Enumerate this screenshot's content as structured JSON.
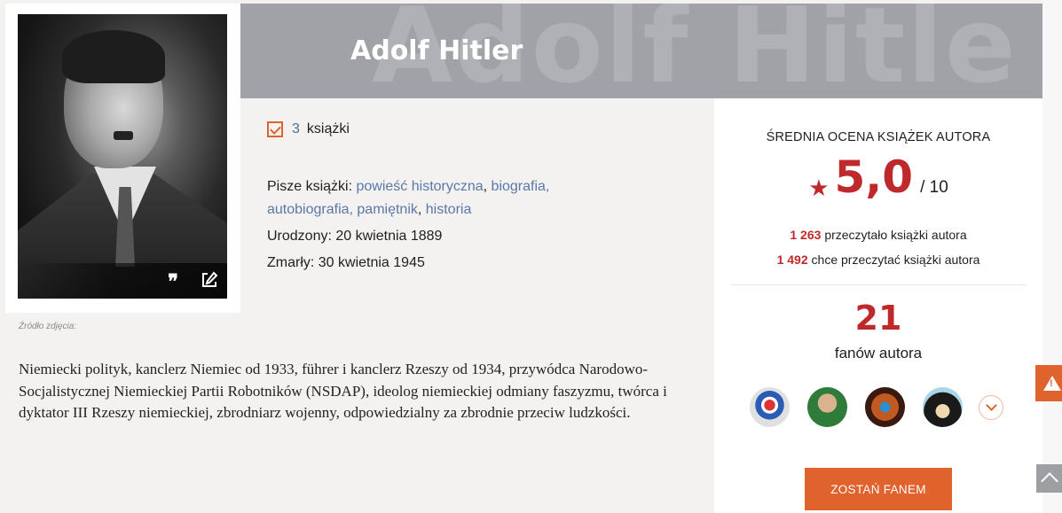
{
  "author": {
    "name": "Adolf Hitler",
    "banner_ghost_text": "Adolf Hitle",
    "photo_source_label": "Źródło zdjęcia:",
    "books": {
      "count": "3",
      "label": "książki"
    },
    "genres_label": "Pisze książki:",
    "genres": [
      "powieść historyczna",
      "biografia, autobiografia, pamiętnik",
      "historia"
    ],
    "born": "Urodzony: 20 kwietnia 1889",
    "died": "Zmarły: 30 kwietnia 1945",
    "bio": "Niemiecki polityk, kanclerz Niemiec od 1933, führer i kanclerz Rzeszy od 1934, przywódca Narodowo-Socjalistycznej Niemieckiej Partii Robotników (NSDAP), ideolog niemieckiej odmiany faszyzmu, twórca i dyktator III Rzeszy niemieckiej, zbrodniarz wojenny, odpowiedzialny za zbrodnie przeciw ludzkości."
  },
  "stats": {
    "avg_label": "ŚREDNIA OCENA KSIĄŻEK AUTORA",
    "rating": "5,0",
    "rating_max": "/ 10",
    "read_count": "1 263",
    "read_label": "przeczytało książki autora",
    "want_count": "1 492",
    "want_label": "chce przeczytać książki autora",
    "fans_count": "21",
    "fans_label": "fanów autora",
    "fan_button": "ZOSTAŃ FANEM"
  },
  "colors": {
    "accent": "#e0622c",
    "rating_red": "#c0292b",
    "link_blue": "#5a78a8",
    "banner_gray": "#a0a2a8"
  },
  "icons": [
    "quote-icon",
    "edit-icon",
    "check-icon",
    "star-icon",
    "chevron-down-icon",
    "warning-icon",
    "chevron-up-icon"
  ]
}
